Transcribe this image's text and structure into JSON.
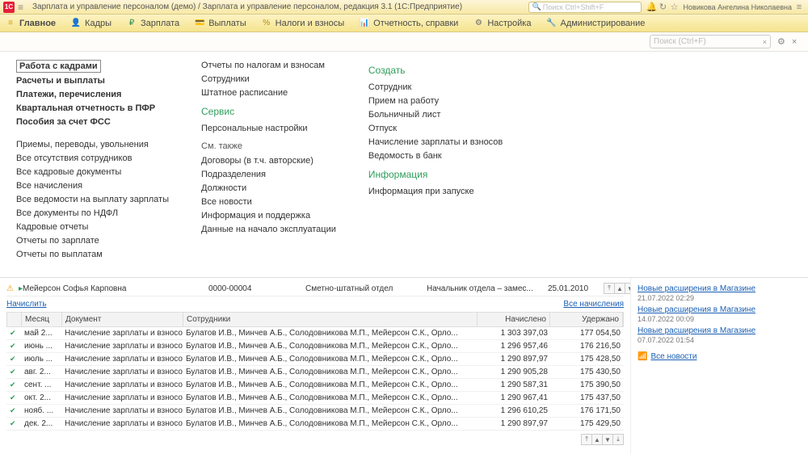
{
  "titlebar": {
    "logo": "1C",
    "title": "Зарплата и управление персоналом (демо) / Зарплата и управление персоналом, редакция 3.1  (1С:Предприятие)",
    "search_ph": "Поиск Ctrl+Shift+F",
    "user": "Новикова Ангелина Николаевна"
  },
  "menu": [
    {
      "icon": "≡",
      "label": "Главное",
      "color": "#d4a017"
    },
    {
      "icon": "👤",
      "label": "Кадры",
      "color": "#6b8e23"
    },
    {
      "icon": "₽",
      "label": "Зарплата",
      "color": "#2e8b57"
    },
    {
      "icon": "💳",
      "label": "Выплаты",
      "color": "#4169e1"
    },
    {
      "icon": "%",
      "label": "Налоги и взносы",
      "color": "#b8860b"
    },
    {
      "icon": "📊",
      "label": "Отчетность, справки",
      "color": "#8b4513"
    },
    {
      "icon": "⚙",
      "label": "Настройка",
      "color": "#696969"
    },
    {
      "icon": "🔧",
      "label": "Администрирование",
      "color": "#696969"
    }
  ],
  "subbar": {
    "search_ph": "Поиск (Ctrl+F)"
  },
  "nav": {
    "col1a": [
      "Работа с кадрами",
      "Расчеты и выплаты",
      "Платежи, перечисления",
      "Квартальная отчетность в ПФР",
      "Пособия за счет ФСС"
    ],
    "col1b": [
      "Приемы, переводы, увольнения",
      "Все отсутствия сотрудников",
      "Все кадровые документы",
      "Все начисления",
      "Все ведомости на выплату зарплаты",
      "Все документы по НДФЛ",
      "Кадровые отчеты",
      "Отчеты по зарплате",
      "Отчеты по выплатам"
    ],
    "col2a": [
      "Отчеты по налогам и взносам",
      "Сотрудники",
      "Штатное расписание"
    ],
    "col2_hd1": "Сервис",
    "col2b": [
      "Персональные настройки"
    ],
    "col2_sub": "См. также",
    "col2c": [
      "Договоры (в т.ч. авторские)",
      "Подразделения",
      "Должности",
      "Все новости",
      "Информация и поддержка",
      "Данные на начало эксплуатации"
    ],
    "col3_hd1": "Создать",
    "col3a": [
      "Сотрудник",
      "Прием на работу",
      "Больничный лист",
      "Отпуск",
      "Начисление зарплаты и взносов",
      "Ведомость в банк"
    ],
    "col3_hd2": "Информация",
    "col3b": [
      "Информация при запуске"
    ]
  },
  "toprow": {
    "name": "Мейерсон Софья Карповна",
    "num": "0000-00004",
    "dept": "Сметно-штатный отдел",
    "pos": "Начальник отдела – замес...",
    "date": "25.01.2010"
  },
  "links": {
    "calc": "Начислить",
    "all": "Все начисления"
  },
  "thdr": {
    "month": "Месяц",
    "doc": "Документ",
    "emp": "Сотрудники",
    "acc": "Начислено",
    "ded": "Удержано"
  },
  "rows": [
    {
      "m": "май 2...",
      "d": "Начисление зарплаты и взносов",
      "s": "Булатов И.В., Минчев А.Б., Солодовникова М.П., Мейерсон С.К., Орло...",
      "n": "1 303 397,03",
      "u": "177 054,50"
    },
    {
      "m": "июнь ...",
      "d": "Начисление зарплаты и взносов",
      "s": "Булатов И.В., Минчев А.Б., Солодовникова М.П., Мейерсон С.К., Орло...",
      "n": "1 296 957,46",
      "u": "176 216,50"
    },
    {
      "m": "июль ...",
      "d": "Начисление зарплаты и взносов",
      "s": "Булатов И.В., Минчев А.Б., Солодовникова М.П., Мейерсон С.К., Орло...",
      "n": "1 290 897,97",
      "u": "175 428,50"
    },
    {
      "m": "авг. 2...",
      "d": "Начисление зарплаты и взносов",
      "s": "Булатов И.В., Минчев А.Б., Солодовникова М.П., Мейерсон С.К., Орло...",
      "n": "1 290 905,28",
      "u": "175 430,50"
    },
    {
      "m": "сент. ...",
      "d": "Начисление зарплаты и взносов",
      "s": "Булатов И.В., Минчев А.Б., Солодовникова М.П., Мейерсон С.К., Орло...",
      "n": "1 290 587,31",
      "u": "175 390,50"
    },
    {
      "m": "окт. 2...",
      "d": "Начисление зарплаты и взносов",
      "s": "Булатов И.В., Минчев А.Б., Солодовникова М.П., Мейерсон С.К., Орло...",
      "n": "1 290 967,41",
      "u": "175 437,50"
    },
    {
      "m": "нояб. ...",
      "d": "Начисление зарплаты и взносов",
      "s": "Булатов И.В., Минчев А.Б., Солодовникова М.П., Мейерсон С.К., Орло...",
      "n": "1 296 610,25",
      "u": "176 171,50"
    },
    {
      "m": "дек. 2...",
      "d": "Начисление зарплаты и взносов",
      "s": "Булатов И.В., Минчев А.Б., Солодовникова М.П., Мейерсон С.К., Орло...",
      "n": "1 290 897,97",
      "u": "175 429,50"
    }
  ],
  "news": [
    {
      "t": "Новые расширения в Магазине",
      "d": "21.07.2022 02:29"
    },
    {
      "t": "Новые расширения в Магазине",
      "d": "14.07.2022 00:09"
    },
    {
      "t": "Новые расширения в Магазине",
      "d": "07.07.2022 01:54"
    }
  ],
  "allnews": "Все новости"
}
